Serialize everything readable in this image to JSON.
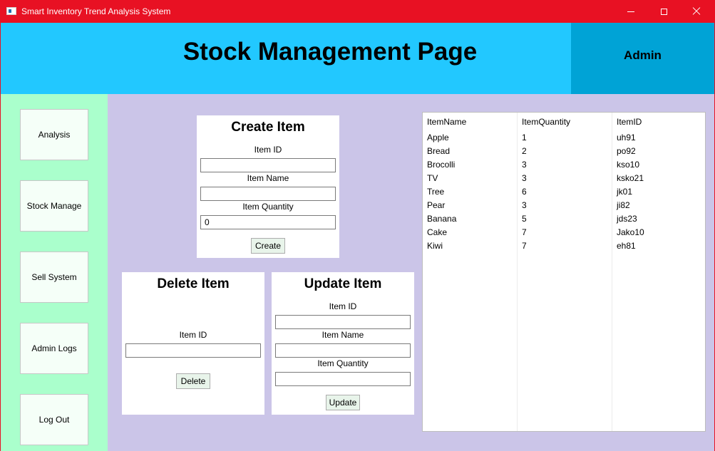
{
  "window": {
    "title": "Smart Inventory Trend Analysis System"
  },
  "header": {
    "title": "Stock Management Page",
    "user": "Admin"
  },
  "sidebar": {
    "items": [
      {
        "label": "Analysis"
      },
      {
        "label": "Stock Manage"
      },
      {
        "label": "Sell System"
      },
      {
        "label": "Admin Logs"
      },
      {
        "label": "Log Out"
      }
    ]
  },
  "create": {
    "title": "Create Item",
    "id_label": "Item ID",
    "name_label": "Item Name",
    "qty_label": "Item Quantity",
    "id_value": "",
    "name_value": "",
    "qty_value": "0",
    "button": "Create"
  },
  "delete": {
    "title": "Delete Item",
    "id_label": "Item ID",
    "id_value": "",
    "button": "Delete"
  },
  "update": {
    "title": "Update Item",
    "id_label": "Item ID",
    "name_label": "Item Name",
    "qty_label": "Item Quantity",
    "id_value": "",
    "name_value": "",
    "qty_value": "",
    "button": "Update"
  },
  "table": {
    "columns": [
      "ItemName",
      "ItemQuantity",
      "ItemID"
    ],
    "rows": [
      [
        "Apple",
        "1",
        "uh91"
      ],
      [
        "Bread",
        "2",
        "po92"
      ],
      [
        "Brocolli",
        "3",
        "kso10"
      ],
      [
        "TV",
        "3",
        "ksko21"
      ],
      [
        "Tree",
        "6",
        "jk01"
      ],
      [
        "Pear",
        "3",
        "ji82"
      ],
      [
        "Banana",
        "5",
        "jds23"
      ],
      [
        "Cake",
        "7",
        "Jako10"
      ],
      [
        "Kiwi",
        "7",
        "eh81"
      ]
    ]
  }
}
